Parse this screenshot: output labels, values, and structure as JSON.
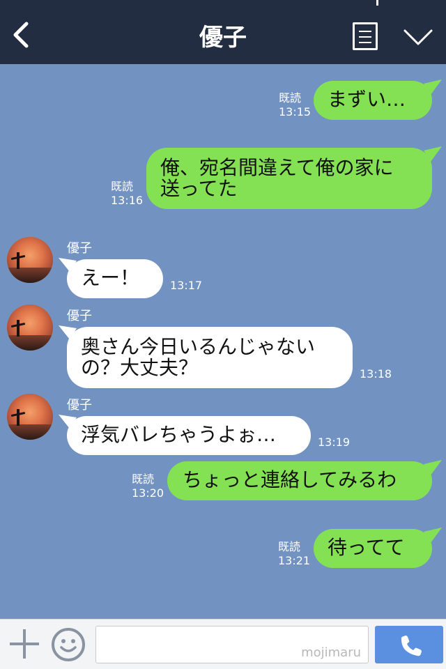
{
  "header": {
    "title": "優子",
    "icons": [
      "back-chevron-icon",
      "menu-list-icon",
      "chevron-down-icon"
    ]
  },
  "messages": [
    {
      "side": "sent",
      "text": "まずい…",
      "read": "既読",
      "time": "13:15"
    },
    {
      "side": "sent",
      "line1": "俺、宛名間違えて俺の家に",
      "line2": "送ってた",
      "read": "既読",
      "time": "13:16"
    },
    {
      "side": "received",
      "sender": "優子",
      "text": "えー！",
      "time": "13:17"
    },
    {
      "side": "received",
      "sender": "優子",
      "line1": "奥さん今日いるんじゃない",
      "line2": "の？大丈夫？",
      "time": "13:18"
    },
    {
      "side": "received",
      "sender": "優子",
      "text": "浮気バレちゃうよぉ…",
      "time": "13:19"
    },
    {
      "side": "sent",
      "text": "ちょっと連絡してみるわ",
      "read": "既読",
      "time": "13:20"
    },
    {
      "side": "sent",
      "text": "待ってて",
      "read": "既読",
      "time": "13:21"
    }
  ],
  "footer": {
    "input_placeholder": "",
    "watermark": "mojimaru",
    "icons": [
      "plus-icon",
      "emoji-icon",
      "phone-icon"
    ]
  },
  "colors": {
    "header_bg": "#232d42",
    "chat_bg": "#7293c1",
    "sent_bubble": "#84e153",
    "received_bubble": "#ffffff",
    "call_button": "#5b8fe0"
  }
}
